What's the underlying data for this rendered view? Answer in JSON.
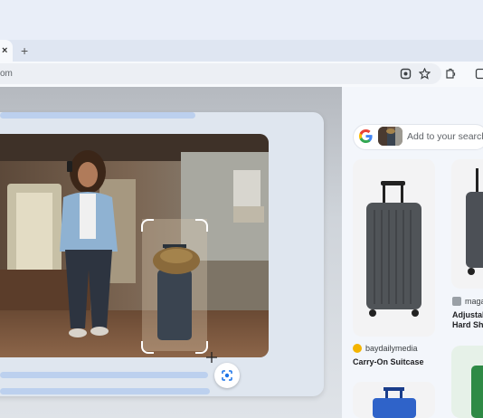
{
  "browser": {
    "tab_close": "×",
    "new_tab": "+",
    "url": "om"
  },
  "side_panel": {
    "search_placeholder": "Add to your search",
    "results": [
      {
        "source": "baydailymedia",
        "title": "Carry-On Suitcase"
      },
      {
        "source": "maga",
        "title_line1": "Adjustab",
        "title_line2": "Hard She"
      }
    ]
  },
  "colors": {
    "accent": "#1a73e8",
    "panel_bg": "#f3f6fb"
  }
}
